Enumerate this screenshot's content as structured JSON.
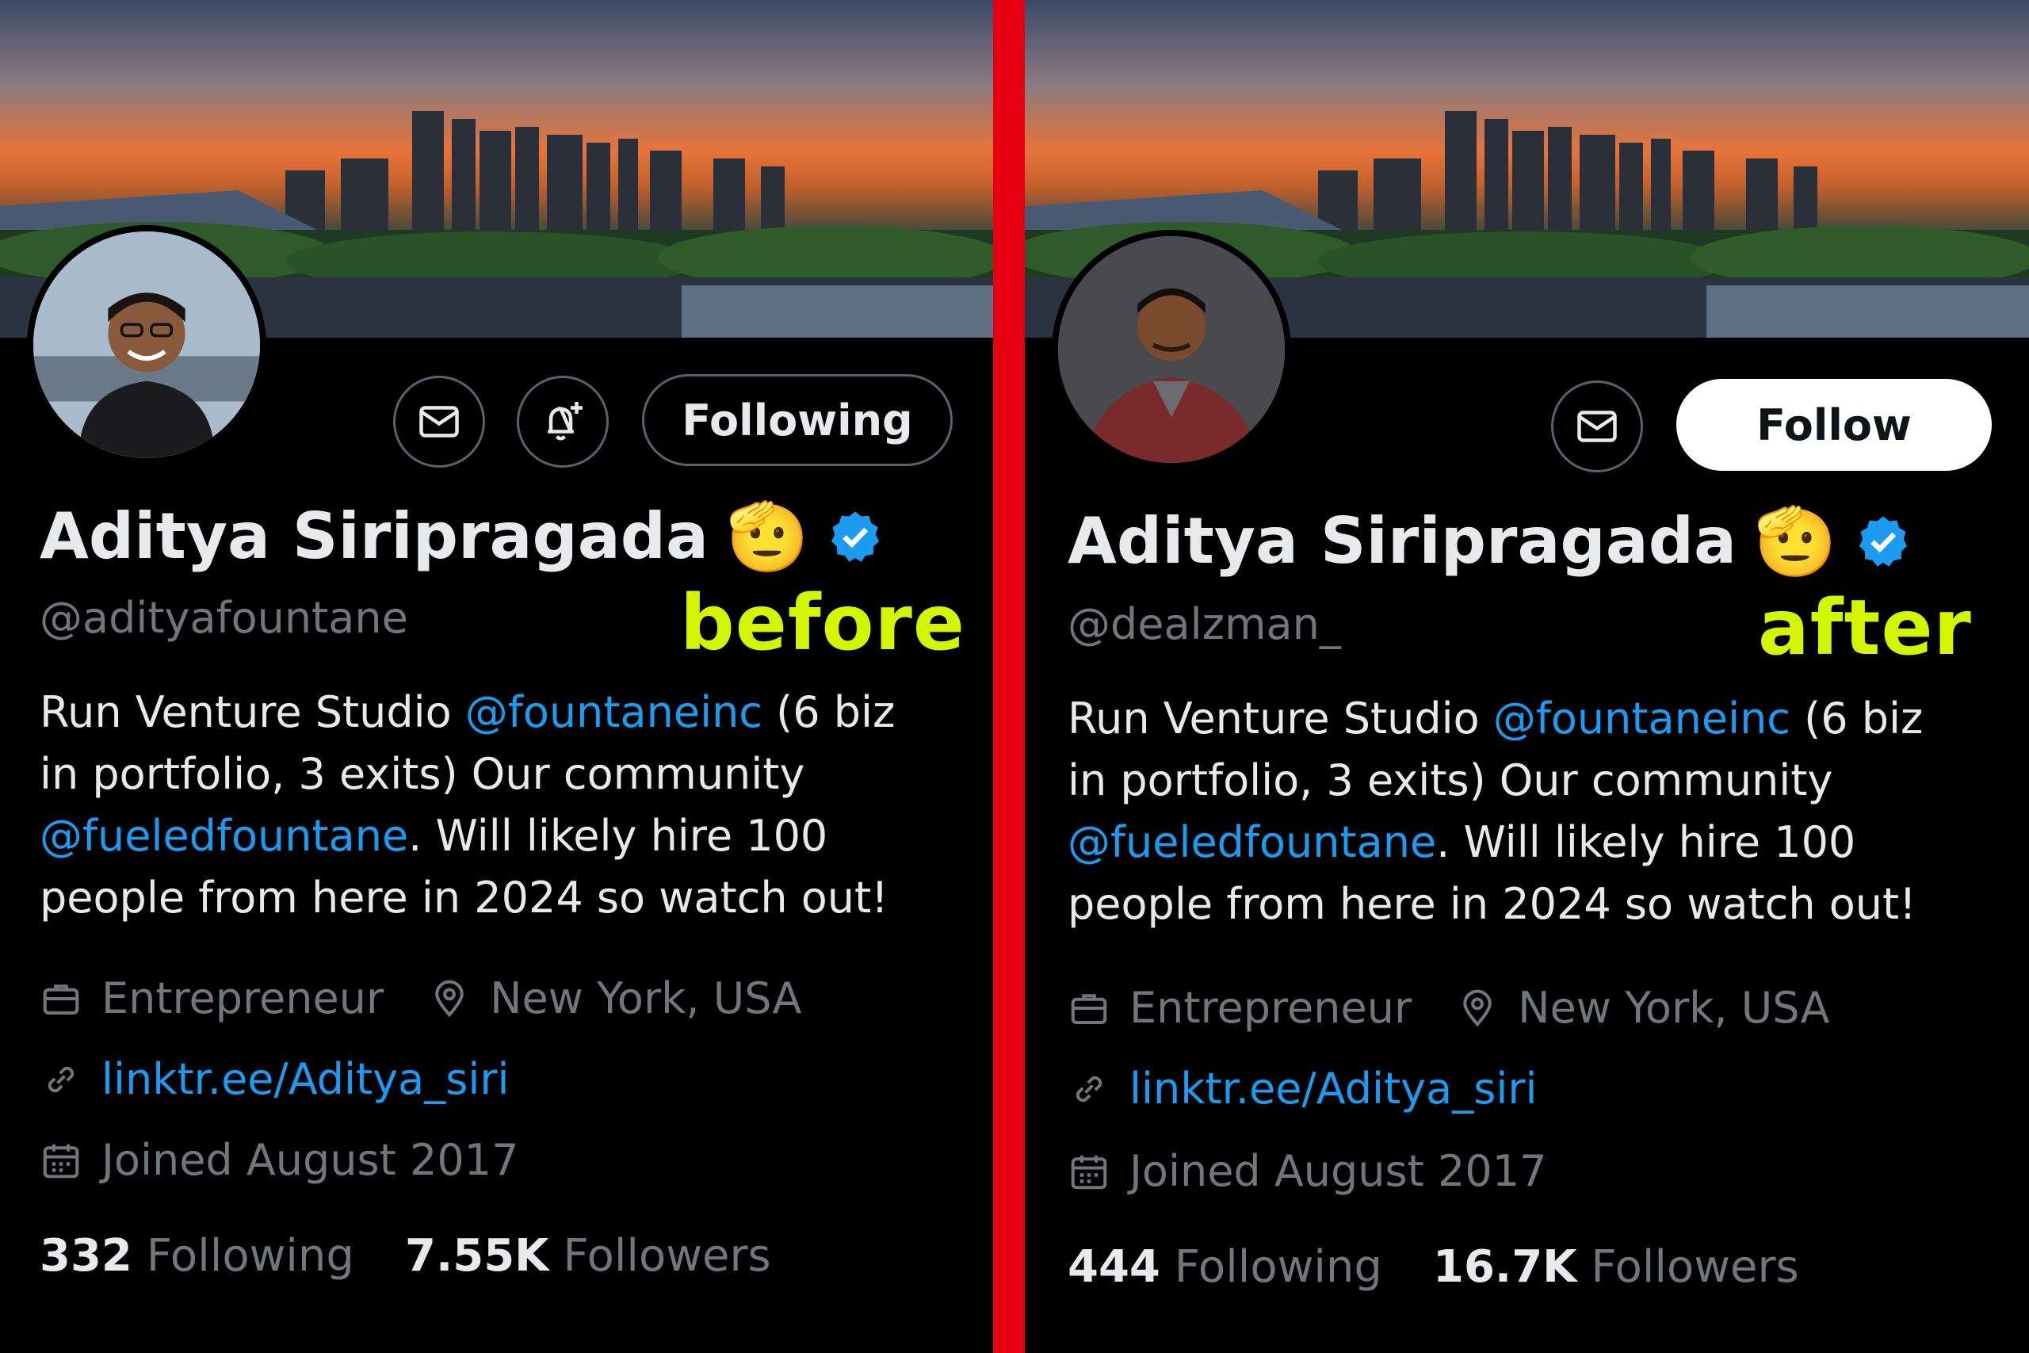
{
  "colors": {
    "accent": "#1d9bf0",
    "overlay": "#d4f500",
    "divider": "#e60012",
    "background": "#000000"
  },
  "before": {
    "label": "before",
    "buttons": {
      "message_icon": "mail-icon",
      "notify_icon": "bell-plus-icon",
      "follow_label": "Following"
    },
    "display_name": "Aditya Siripragada",
    "name_emoji": "🫡",
    "handle": "@adityafountane",
    "bio": {
      "part1": "Run Venture Studio ",
      "mention1": "@fountaneinc",
      "part2": "  (6 biz in portfolio, 3 exits) Our community ",
      "mention2": "@fueledfountane",
      "part3": ". Will likely hire 100 people from here in 2024 so watch out!"
    },
    "profession": "Entrepreneur",
    "location": "New York, USA",
    "website": "linktr.ee/Aditya_siri",
    "joined": "Joined August 2017",
    "following_count": "332",
    "following_label": "Following",
    "followers_count": "7.55K",
    "followers_label": "Followers"
  },
  "after": {
    "label": "after",
    "buttons": {
      "message_icon": "mail-icon",
      "follow_label": "Follow"
    },
    "display_name": "Aditya Siripragada",
    "name_emoji": "🫡",
    "handle": "@dealzman_",
    "bio": {
      "part1": "Run Venture Studio ",
      "mention1": "@fountaneinc",
      "part2": "  (6 biz in portfolio, 3 exits) Our community ",
      "mention2": "@fueledfountane",
      "part3": ". Will likely hire 100 people from here in 2024 so watch out!"
    },
    "profession": "Entrepreneur",
    "location": "New York, USA",
    "website": "linktr.ee/Aditya_siri",
    "joined": "Joined August 2017",
    "following_count": "444",
    "following_label": "Following",
    "followers_count": "16.7K",
    "followers_label": "Followers"
  }
}
